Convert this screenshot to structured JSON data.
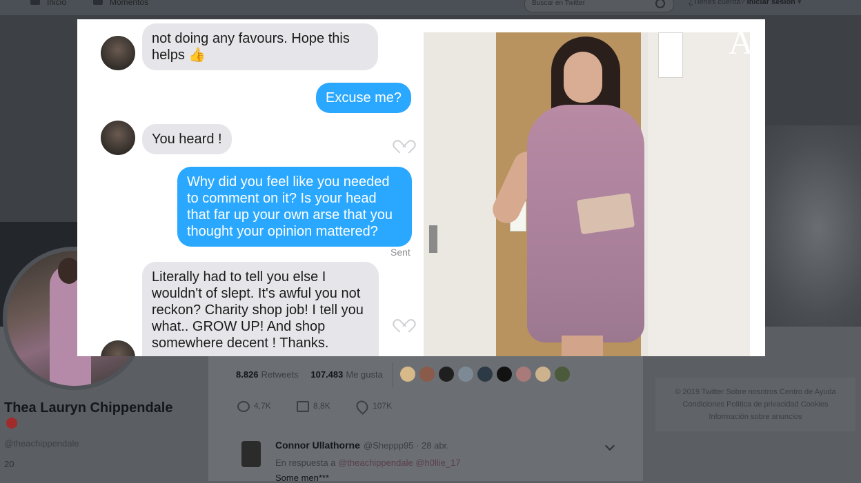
{
  "nav": {
    "home": "Inicio",
    "moments": "Momentos",
    "search_placeholder": "Buscar en Twitter",
    "login_prompt": "¿Tienes cuenta?",
    "login_link": "Iniciar sesión"
  },
  "profile": {
    "name": "Thea Lauryn Chippendale",
    "handle": "@theachippendale",
    "joined": "20"
  },
  "tweet": {
    "retweets_count": "8.826",
    "retweets_label": "Retweets",
    "likes_count": "107.483",
    "likes_label": "Me gusta",
    "replies": "4,7K",
    "retweet_action": "8,8K",
    "like_action": "107K"
  },
  "reply": {
    "name": "Connor Ullathorne",
    "meta": "@Sheppp95 · 28 abr.",
    "in_reply_prefix": "En respuesta a",
    "in_reply_mentions": "@theachippendale @h0llie_17",
    "text": "Some men***"
  },
  "footer": {
    "line1": "© 2019 Twitter   Sobre nosotros   Centro de Ayuda",
    "line2": "Condiciones   Política de privacidad   Cookies",
    "line3": "Información sobre anuncios"
  },
  "chat": {
    "msg1": "not doing any favours. Hope this helps 👍",
    "msg2": "Excuse me?",
    "msg3": "You heard !",
    "msg4": "Why did you feel like you needed to comment on it? Is your head that far up your own arse that you thought your opinion mattered?",
    "sent": "Sent",
    "msg5": "Literally had to tell you else I wouldn't of slept. It's awful you not reckon? Charity shop job! I tell you what.. GROW UP! And shop somewhere decent ! Thanks."
  },
  "watermark": "ABC",
  "colors": {
    "bubble_blue": "#2aa8ff",
    "bubble_grey": "#e6e6ea",
    "watermark_dot": "#d8162a"
  }
}
